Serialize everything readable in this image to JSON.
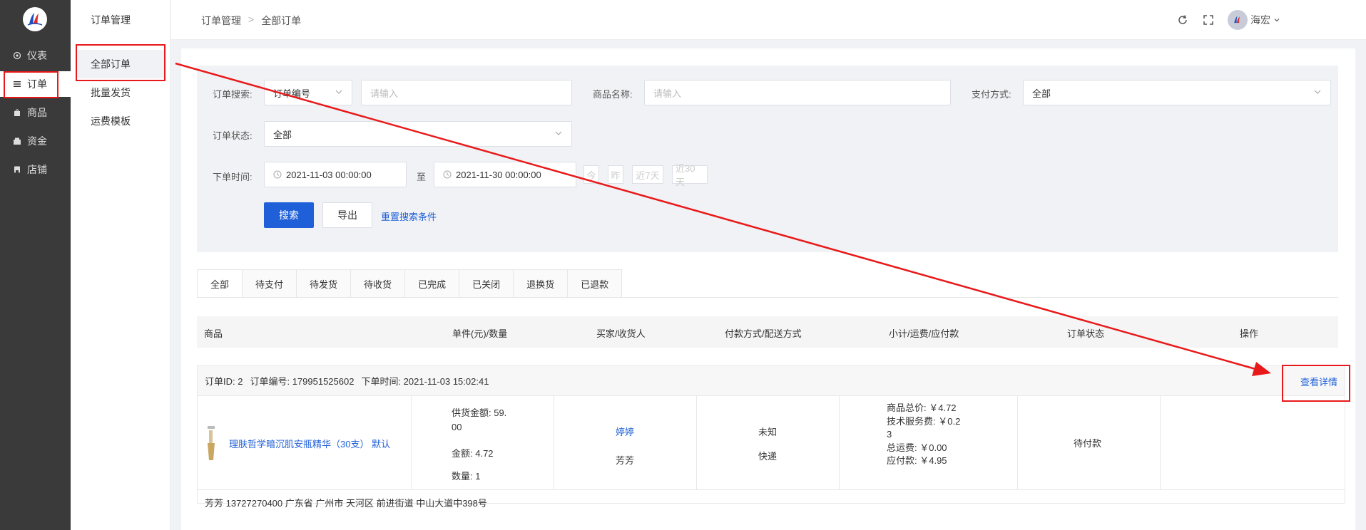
{
  "sidebar": {
    "items": [
      {
        "label": "仪表",
        "icon": "gear-icon"
      },
      {
        "label": "订单",
        "icon": "list-icon"
      },
      {
        "label": "商品",
        "icon": "bag-icon"
      },
      {
        "label": "资金",
        "icon": "wallet-icon"
      },
      {
        "label": "店铺",
        "icon": "store-icon"
      }
    ]
  },
  "subnav": {
    "title": "订单管理",
    "items": [
      {
        "label": "全部订单"
      },
      {
        "label": "批量发货"
      },
      {
        "label": "运费模板"
      }
    ]
  },
  "header": {
    "breadcrumb": [
      "订单管理",
      "全部订单"
    ],
    "user": "海宏"
  },
  "search": {
    "order_search_label": "订单搜索:",
    "order_search_type": "订单编号",
    "order_search_placeholder": "请输入",
    "product_name_label": "商品名称:",
    "product_name_placeholder": "请输入",
    "payment_label": "支付方式:",
    "payment_value": "全部",
    "status_label": "订单状态:",
    "status_value": "全部",
    "time_label": "下单时间:",
    "start_time": "2021-11-03 00:00:00",
    "to_label": "至",
    "end_time": "2021-11-30 00:00:00",
    "quick": [
      "今",
      "昨",
      "近7天",
      "近30天"
    ],
    "search_button": "搜索",
    "export_button": "导出",
    "reset_link": "重置搜索条件"
  },
  "tabs": [
    "全部",
    "待支付",
    "待发货",
    "待收货",
    "已完成",
    "已关闭",
    "退换货",
    "已退款"
  ],
  "table": {
    "columns": [
      "商品",
      "单件(元)/数量",
      "买家/收货人",
      "付款方式/配送方式",
      "小计/运费/应付款",
      "订单状态",
      "操作"
    ]
  },
  "order": {
    "id_text": "订单ID: 2",
    "number_text": "订单编号: 179951525602",
    "time_text": "下单时间: 2021-11-03 15:02:41",
    "detail_link": "查看详情",
    "product_name": "理肤哲学暗沉肌安瓶精华（30支） 默认",
    "supply_line1": "供货金额: 59.",
    "supply_line2": "00",
    "amount": "金额: 4.72",
    "quantity": "数量: 1",
    "buyer": "婷婷",
    "receiver": "芳芳",
    "payment": "未知",
    "delivery": "快递",
    "goods_total": "商品总价: ￥4.72",
    "service_fee_line1": "技术服务费: ￥0.2",
    "service_fee_line2": "3",
    "shipping": "总运费: ￥0.00",
    "payable": "应付款: ￥4.95",
    "status": "待付款",
    "address": "芳芳 13727270400 广东省 广州市 天河区 前进街道 中山大道中398号"
  }
}
